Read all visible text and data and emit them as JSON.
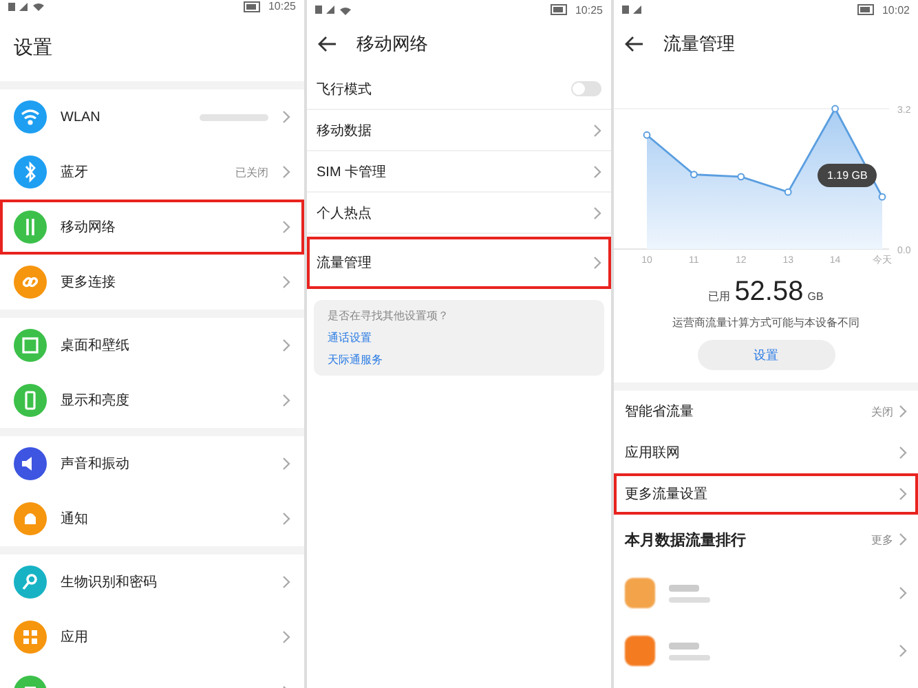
{
  "panels": [
    {
      "status_bar": {
        "time": "10:25",
        "wifi": true
      },
      "title": "设置",
      "groups": [
        {
          "items": [
            {
              "label": "WLAN",
              "value_blurred": true,
              "color": "#1e9ff2",
              "highlighted": false
            },
            {
              "label": "蓝牙",
              "value": "已关闭",
              "color": "#1e9ff2",
              "highlighted": false
            },
            {
              "label": "移动网络",
              "color": "#3cc04a",
              "highlighted": true
            },
            {
              "label": "更多连接",
              "color": "#f6950e",
              "highlighted": false
            }
          ]
        },
        {
          "items": [
            {
              "label": "桌面和壁纸",
              "color": "#3cc04a",
              "highlighted": false
            },
            {
              "label": "显示和亮度",
              "color": "#3cc04a",
              "highlighted": false
            }
          ]
        },
        {
          "items": [
            {
              "label": "声音和振动",
              "color": "#3d55e0",
              "highlighted": false
            },
            {
              "label": "通知",
              "color": "#f6950e",
              "highlighted": false
            }
          ]
        },
        {
          "items": [
            {
              "label": "生物识别和密码",
              "color": "#17b3c4",
              "highlighted": false
            },
            {
              "label": "应用",
              "color": "#f6950e",
              "highlighted": false
            },
            {
              "color": "#3cc04a",
              "highlighted": false
            }
          ]
        }
      ]
    },
    {
      "status_bar": {
        "time": "10:25",
        "wifi": true
      },
      "title": "移动网络",
      "back": true,
      "rows": [
        {
          "kind": "toggle",
          "label": "飞行模式",
          "on": false,
          "highlighted": false
        },
        {
          "kind": "link",
          "label": "移动数据",
          "highlighted": false
        },
        {
          "kind": "link",
          "label": "SIM 卡管理",
          "highlighted": false
        },
        {
          "kind": "link",
          "label": "个人热点",
          "highlighted": false
        },
        {
          "kind": "link",
          "label": "流量管理",
          "highlighted": true
        }
      ],
      "suggestion": {
        "question": "是否在寻找其他设置项？",
        "links": [
          "通话设置",
          "天际通服务"
        ]
      }
    },
    {
      "status_bar": {
        "time": "10:02"
      },
      "title": "流量管理",
      "back": true,
      "chart_data": {
        "type": "area",
        "categories": [
          "10",
          "11",
          "12",
          "13",
          "14",
          "今天"
        ],
        "series": [
          {
            "color": "#5a9ee0",
            "values": [
              2.6,
              1.7,
              1.65,
              1.3,
              3.2,
              1.19
            ]
          }
        ],
        "ylim": [
          0,
          3.2
        ],
        "yticks": [
          {
            "value": 0,
            "label": "0.0"
          },
          {
            "value": 3.2,
            "label": "3.2"
          }
        ]
      },
      "tooltip": "1.19 GB",
      "used_label": "已用",
      "used_value": "52.58",
      "used_unit": "GB",
      "note": "运营商流量计算方式可能与本设备不同",
      "button": "设置",
      "rows": [
        {
          "label": "智能省流量",
          "value": "关闭",
          "highlighted": false
        },
        {
          "label": "应用联网",
          "highlighted": false
        },
        {
          "label": "更多流量设置",
          "highlighted": true
        }
      ],
      "ranking": {
        "title": "本月数据流量排行",
        "more": "更多",
        "apps": [
          {
            "color": "#f3a34a"
          },
          {
            "color": "#f47b20"
          }
        ]
      }
    }
  ]
}
